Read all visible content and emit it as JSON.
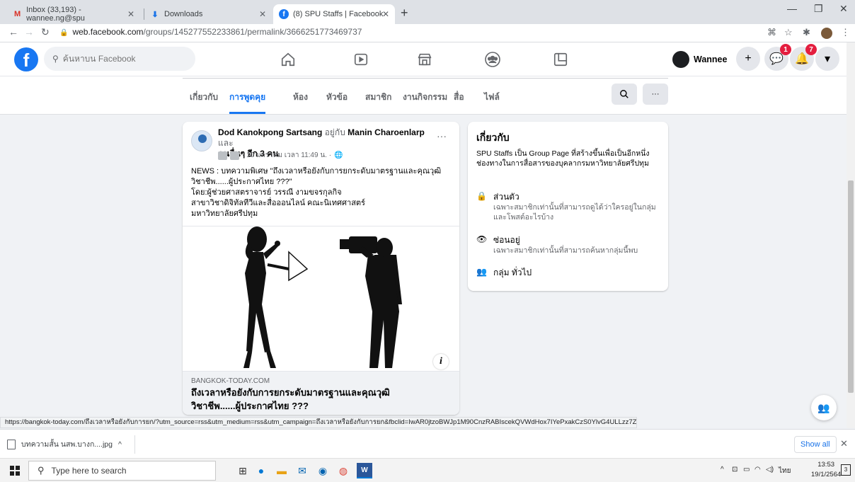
{
  "browser": {
    "tabs": [
      {
        "label": "Inbox (33,193) - wannee.ng@spu",
        "icon": "gmail-icon"
      },
      {
        "label": "Downloads",
        "icon": "download-icon"
      },
      {
        "label": "(8) SPU Staffs | Facebook",
        "icon": "facebook-icon"
      }
    ],
    "url_host": "web.facebook.com",
    "url_path": "/groups/145277552233861/permalink/3666251773469737"
  },
  "fb": {
    "search_placeholder": "ค้นหาบน Facebook",
    "user_name": "Wannee",
    "messenger_badge": "1",
    "notif_badge": "7"
  },
  "group_nav": {
    "tabs": [
      "เกี่ยวกับ",
      "การพูดคุย",
      "ห้อง",
      "หัวข้อ",
      "สมาชิก",
      "งานกิจกรรม",
      "สื่อ",
      "ไฟล์"
    ],
    "active": "การพูดคุย",
    "search_icon": "search-icon",
    "more_label": "···"
  },
  "post": {
    "author": "Dod Kanokpong Sartsang",
    "with_text": "อยู่กับ",
    "with_name": "Manin Charoenlarp",
    "and_text": "และ",
    "others": "คนอื่นๆ อีก 3 คน",
    "meta": "· 10 มกราคม เวลา 11:49 น. ·",
    "more": "···",
    "body_lines": [
      "NEWS : บทความพิเศษ \"ถึงเวลาหรือยังกับการยกระดับมาตรฐานและคุณวุฒิ",
      "วิชาชีพ......ผู้ประกาศไทย ???\"",
      "โดย:ผู้ช่วยศาสตราจารย์ วรรณี งามขจรกุลกิจ",
      "สาขาวิชาดิจิทัลทีวีและสื่อออนไลน์ คณะนิเทศศาสตร์",
      "มหาวิทยาลัยศรีปทุม"
    ],
    "link_domain": "BANGKOK-TODAY.COM",
    "link_title_1": "ถึงเวลาหรือยังกับการยกระดับมาตรฐานและคุณวุฒิ",
    "link_title_2": "วิชาชีพ......ผู้ประกาศไทย ???",
    "info_label": "i"
  },
  "about": {
    "title": "เกี่ยวกับ",
    "desc": "SPU Staffs เป็น Group Page ที่สร้างขึ้นเพื่อเป็นอีกหนึ่งช่องทางในการสื่อสารของบุคลากรมหาวิทยาลัยศรีปทุม",
    "private_title": "ส่วนตัว",
    "private_sub": "เฉพาะสมาชิกเท่านั้นที่สามารถดูได้ว่าใครอยู่ในกลุ่มและโพสต์อะไรบ้าง",
    "hidden_title": "ซ่อนอยู่",
    "hidden_sub": "เฉพาะสมาชิกเท่านั้นที่สามารถค้นหากลุ่มนี้พบ",
    "general": "กลุ่ม ทั่วไป"
  },
  "status_url": "https://bangkok-today.com/ถึงเวลาหรือยังกับการยก/?utm_source=rss&utm_medium=rss&utm_campaign=ถึงเวลาหรือยังกับการยก&fbclid=IwAR0jtzoBWJp1M90CnzRABIscekQVWdHox7IYePxakCzS0YlvG4ULLzz7Z9I",
  "downloads": {
    "file": "บทความสั้น นสพ.บางก....jpg",
    "chevron": "^",
    "show_all": "Show all",
    "close": "✕"
  },
  "taskbar": {
    "search_placeholder": "Type here to search",
    "lang": "ไทย",
    "time": "13:53",
    "date": "19/1/2564",
    "notif_count": "3"
  }
}
